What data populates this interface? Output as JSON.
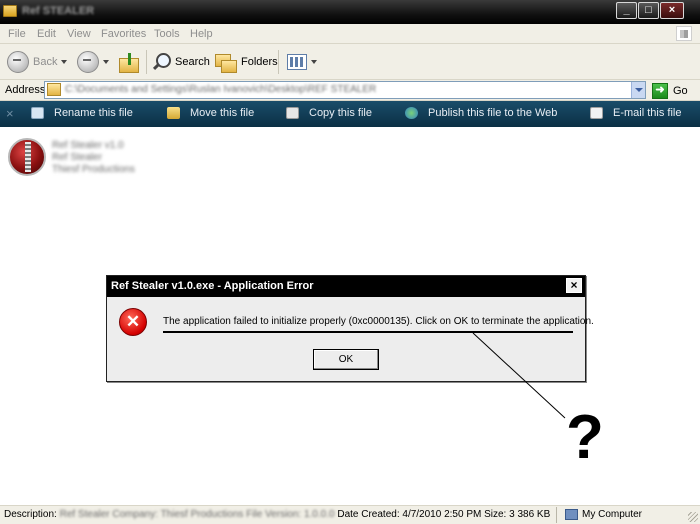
{
  "window": {
    "title": "Ref STEALER"
  },
  "menu": [
    "File",
    "Edit",
    "View",
    "Favorites",
    "Tools",
    "Help"
  ],
  "toolbar": {
    "back_label": "Back",
    "search_label": "Search",
    "folders_label": "Folders"
  },
  "address": {
    "label": "Address",
    "path": "C:\\Documents and Settings\\Ruslan Ivanovich\\Desktop\\REF STEALER",
    "go_label": "Go"
  },
  "tasks": [
    {
      "label": "Rename this file",
      "icon": "rename-icon"
    },
    {
      "label": "Move this file",
      "icon": "move-icon"
    },
    {
      "label": "Copy this file",
      "icon": "copy-icon"
    },
    {
      "label": "Publish this file to the Web",
      "icon": "web-icon"
    },
    {
      "label": "E-mail this file",
      "icon": "mail-icon"
    }
  ],
  "file": {
    "name": "Ref Stealer v1.0",
    "description": "Ref Stealer",
    "company": "Thiesf Productions"
  },
  "dialog": {
    "title": "Ref Stealer v1.0.exe - Application Error",
    "message": "The application failed to initialize properly (0xc0000135). Click on OK to terminate the application.",
    "ok_label": "OK",
    "close_glyph": "×"
  },
  "annotation": {
    "text": "?"
  },
  "status": {
    "description_label": "Description:",
    "description_value": "Ref Stealer Company: Thiesf Productions File Version: 1.0.0.0",
    "details": "Date Created: 4/7/2010 2:50 PM Size: 3 386 KB",
    "location": "My Computer"
  },
  "colors": {
    "taskbar": "#0b2f44",
    "error_red": "#d40000",
    "title_black": "#000000"
  }
}
